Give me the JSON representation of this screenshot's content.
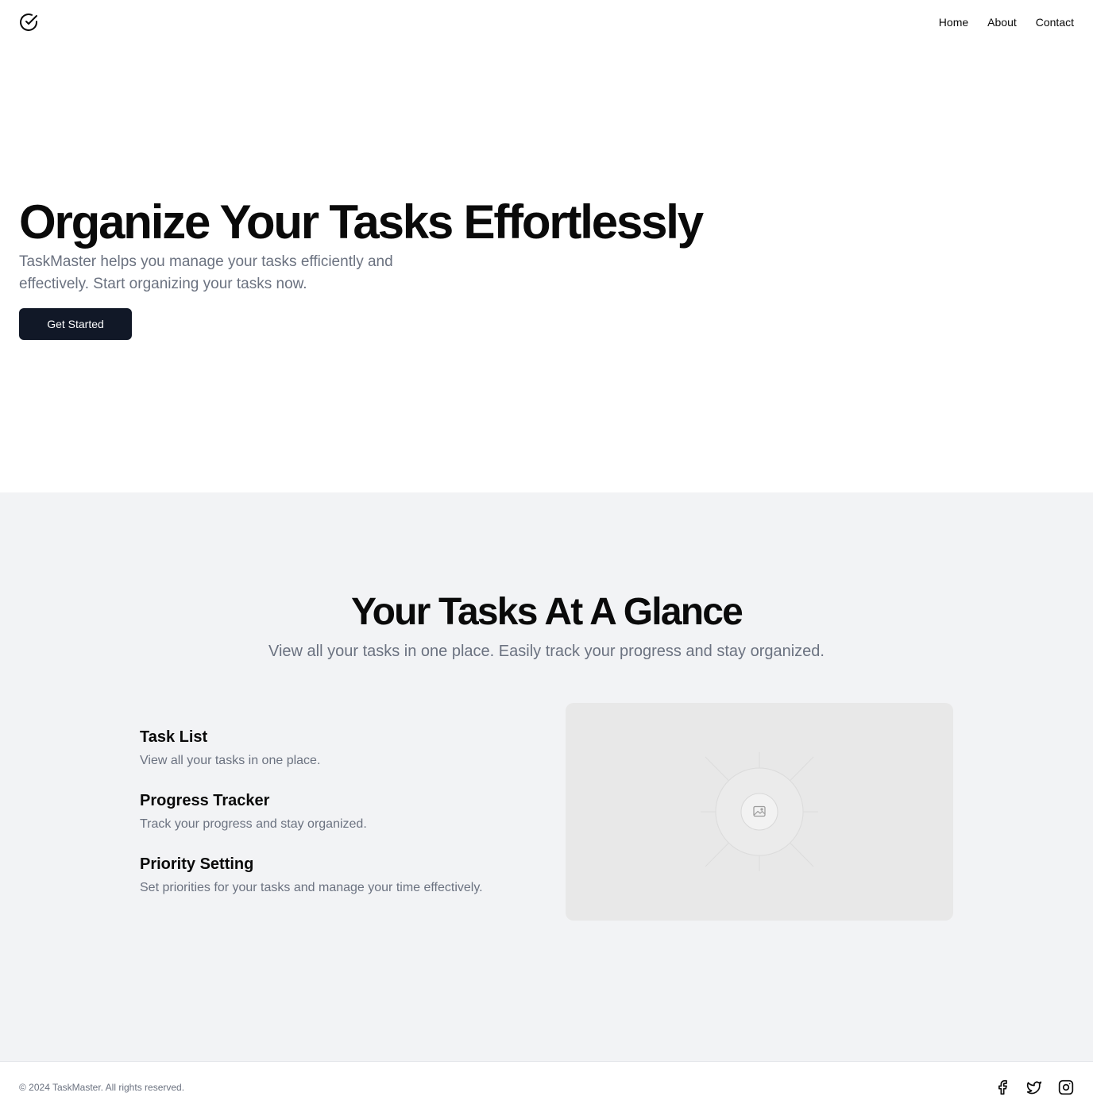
{
  "header": {
    "logo_icon": "check-circle-icon",
    "nav": [
      "Home",
      "About",
      "Contact"
    ]
  },
  "hero": {
    "title": "Organize Your Tasks Effortlessly",
    "subtitle": "TaskMaster helps you manage your tasks efficiently and effectively. Start organizing your tasks now.",
    "cta_label": "Get Started"
  },
  "features": {
    "title": "Your Tasks At A Glance",
    "subtitle": "View all your tasks in one place. Easily track your progress and stay organized.",
    "items": [
      {
        "title": "Task List",
        "description": "View all your tasks in one place."
      },
      {
        "title": "Progress Tracker",
        "description": "Track your progress and stay organized."
      },
      {
        "title": "Priority Setting",
        "description": "Set priorities for your tasks and manage your time effectively."
      }
    ],
    "image_icon": "image-placeholder-icon"
  },
  "footer": {
    "copyright": "© 2024 TaskMaster. All rights reserved.",
    "social_icons": [
      "facebook-icon",
      "twitter-icon",
      "instagram-icon"
    ]
  },
  "colors": {
    "primary_button": "#111827",
    "section_background": "#f2f3f5",
    "muted_text": "#6b7280"
  }
}
